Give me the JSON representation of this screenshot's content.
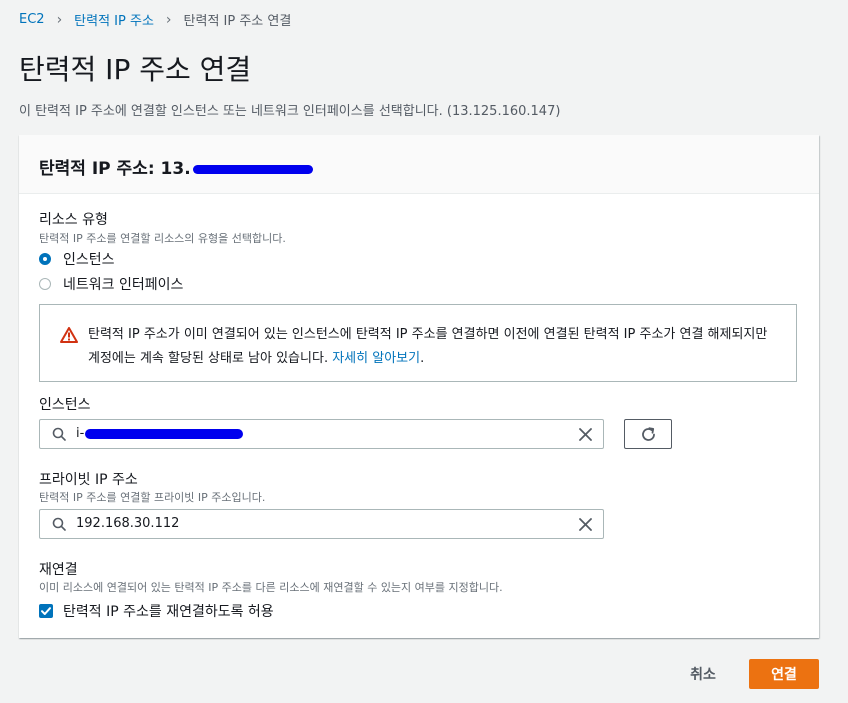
{
  "breadcrumb": {
    "root": "EC2",
    "parent": "탄력적 IP 주소",
    "current": "탄력적 IP 주소 연결"
  },
  "page": {
    "title": "탄력적 IP 주소 연결",
    "description": "이 탄력적 IP 주소에 연결할 인스턴스 또는 네트워크 인터페이스를 선택합니다. (13.125.160.147)"
  },
  "panel": {
    "title_prefix": "탄력적 IP 주소: 13."
  },
  "resource_type": {
    "label": "리소스 유형",
    "description": "탄력적 IP 주소를 연결할 리소스의 유형을 선택합니다.",
    "options": [
      {
        "label": "인스턴스",
        "selected": true
      },
      {
        "label": "네트워크 인터페이스",
        "selected": false
      }
    ]
  },
  "alert": {
    "text": "탄력적 IP 주소가 이미 연결되어 있는 인스턴스에 탄력적 IP 주소를 연결하면 이전에 연결된 탄력적 IP 주소가 연결 해제되지만 계정에는 계속 할당된 상태로 남아 있습니다.",
    "link": "자세히 알아보기",
    "suffix": "."
  },
  "instance": {
    "label": "인스턴스",
    "value": "i-"
  },
  "private_ip": {
    "label": "프라이빗 IP 주소",
    "description": "탄력적 IP 주소를 연결할 프라이빗 IP 주소입니다.",
    "value": "192.168.30.112"
  },
  "reassociate": {
    "label": "재연결",
    "description": "이미 리소스에 연결되어 있는 탄력적 IP 주소를 다른 리소스에 재연결할 수 있는지 여부를 지정합니다.",
    "checkbox_label": "탄력적 IP 주소를 재연결하도록 허용",
    "checked": true
  },
  "actions": {
    "cancel": "취소",
    "submit": "연결"
  },
  "icons": [
    "chevron-right-icon",
    "warning-icon",
    "search-icon",
    "clear-icon",
    "refresh-icon",
    "checkmark-icon"
  ],
  "colors": {
    "link": "#0073bb",
    "primary": "#ec7211",
    "warning": "#d13212",
    "redaction": "#0000ee"
  }
}
